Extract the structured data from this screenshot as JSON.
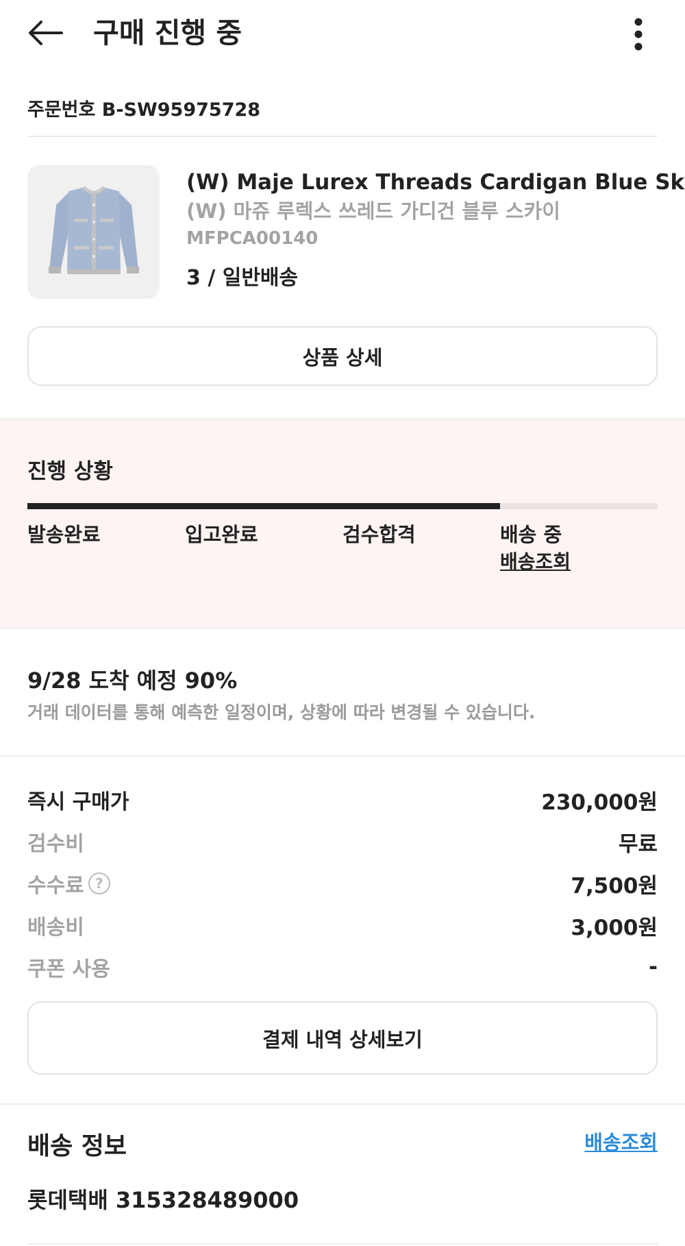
{
  "header": {
    "title": "구매 진행 중"
  },
  "order": {
    "number_label": "주문번호 B-SW95975728"
  },
  "product": {
    "name_en": "(W) Maje Lurex Threads Cardigan Blue Sky",
    "name_ko": "(W) 마쥬 루렉스 쓰레드 가디건 블루 스카이",
    "code": "MFPCA00140",
    "option": "3 / 일반배송",
    "detail_button": "상품 상세"
  },
  "progress": {
    "title": "진행 상황",
    "fraction": 0.75,
    "steps": [
      {
        "label": "발송완료"
      },
      {
        "label": "입고완료"
      },
      {
        "label": "검수합격"
      },
      {
        "label": "배송 중",
        "link": "배송조회"
      }
    ]
  },
  "arrival": {
    "title": "9/28 도착 예정 90%",
    "note": "거래 데이터를 통해 예측한 일정이며, 상황에 따라 변경될 수 있습니다."
  },
  "price": {
    "rows": [
      {
        "label": "즉시 구매가",
        "value": "230,000원"
      },
      {
        "label": "검수비",
        "value": "무료"
      },
      {
        "label": "수수료",
        "value": "7,500원"
      },
      {
        "label": "배송비",
        "value": "3,000원"
      },
      {
        "label": "쿠폰 사용",
        "value": "-"
      }
    ],
    "help_symbol": "?"
  },
  "payment_button": "결제 내역 상세보기",
  "delivery": {
    "title": "배송 정보",
    "link": "배송조회",
    "courier": "롯데택배 315328489000"
  },
  "colors": {
    "progress_bg": "#fdf4f3",
    "progress_fill": "#222222",
    "link": "#2a8bd9"
  }
}
